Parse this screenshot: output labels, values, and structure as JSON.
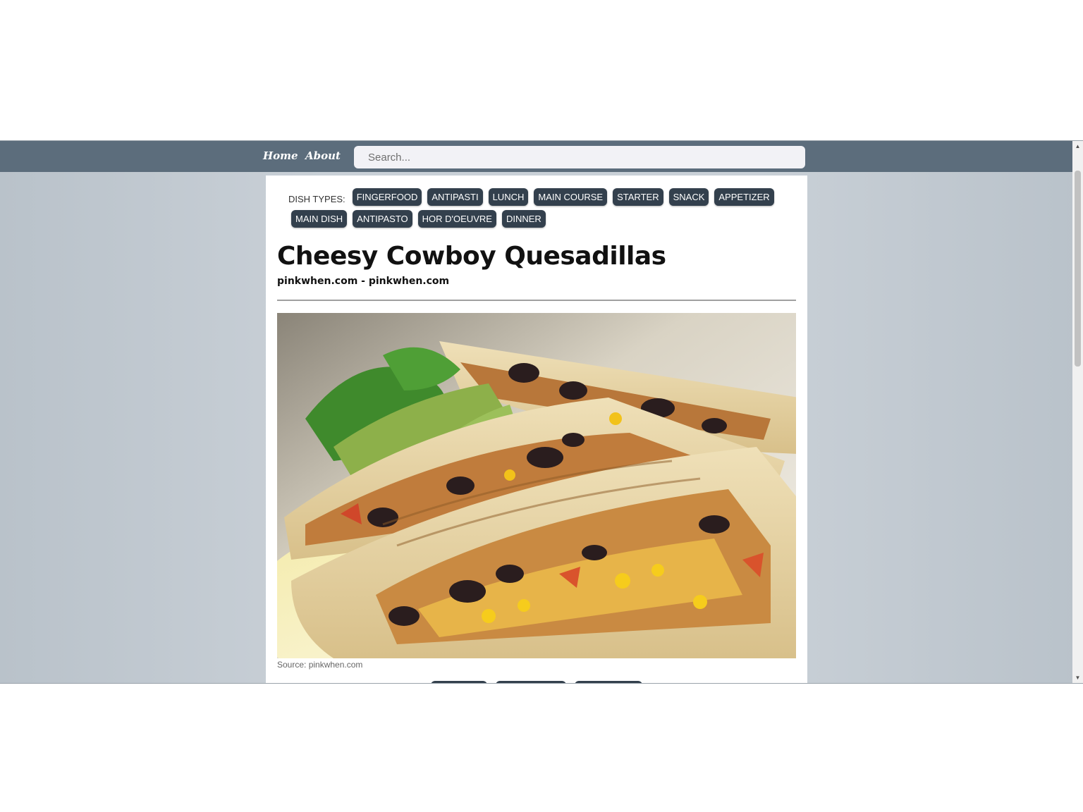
{
  "nav": {
    "home_label": "Home",
    "about_label": "About",
    "search_placeholder": "Search..."
  },
  "dish_types": {
    "label": "DISH TYPES:",
    "tags": [
      "FINGERFOOD",
      "ANTIPASTI",
      "LUNCH",
      "MAIN COURSE",
      "STARTER",
      "SNACK",
      "APPETIZER",
      "MAIN DISH",
      "ANTIPASTO",
      "HOR D'OEUVRE",
      "DINNER"
    ]
  },
  "recipe": {
    "title": "Cheesy Cowboy Quesadillas",
    "source_line": "pinkwhen.com - pinkwhen.com",
    "image_caption": "Source: pinkwhen.com"
  },
  "colors": {
    "navbar": "#5c6d7c",
    "tag_background": "#33404d",
    "page_background": "#c9d0d7"
  },
  "icons": {
    "scroll_up": "triangle-up-icon",
    "scroll_down": "triangle-down-icon"
  }
}
